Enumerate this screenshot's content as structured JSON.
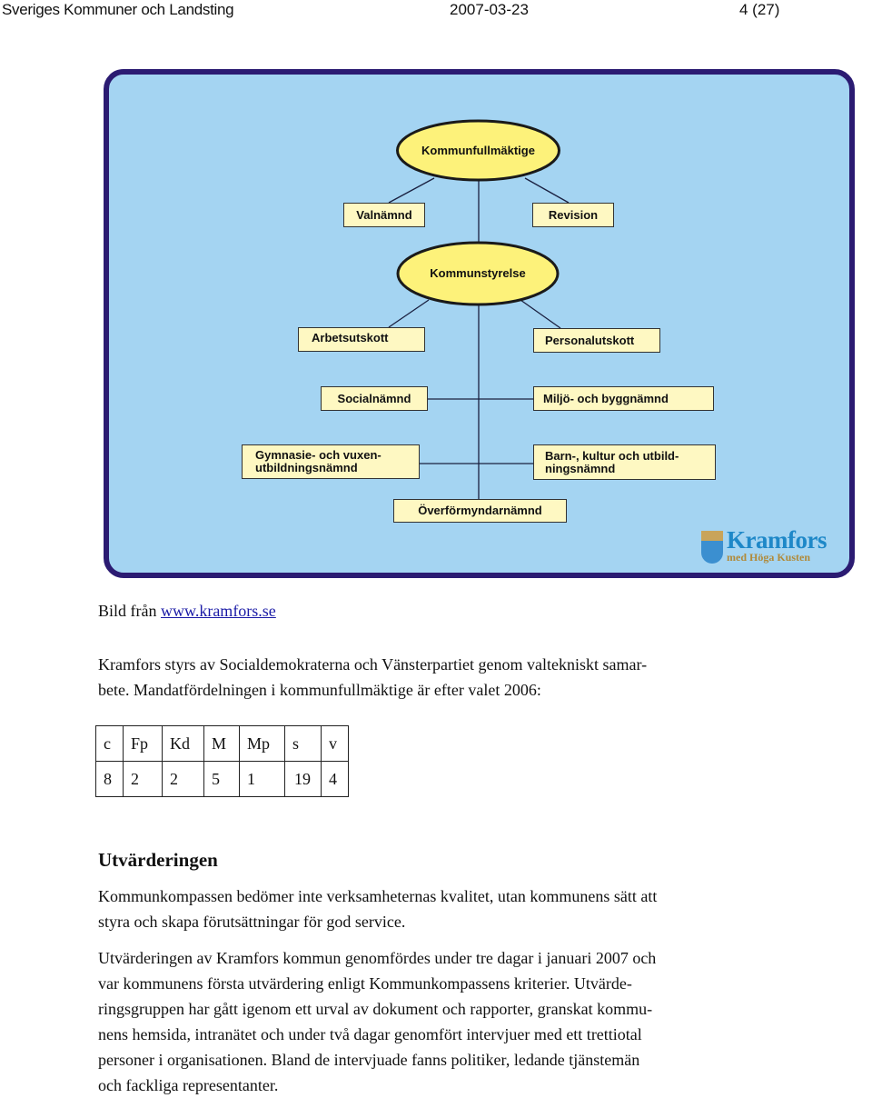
{
  "header": {
    "organization": "Sveriges Kommuner och Landsting",
    "date": "2007-03-23",
    "page": "4 (27)"
  },
  "diagram": {
    "colors": {
      "frame_border": "#2b1b72",
      "background": "#a4d4f2",
      "node_fill": "#fef8c2",
      "ellipse_fill": "#fdf27a"
    },
    "top_ellipse": "Kommunfullmäktige",
    "second_ellipse": "Kommunstyrelse",
    "boxes": {
      "valnamnd": "Valnämnd",
      "revision": "Revision",
      "arbetsutskott": "Arbetsutskott",
      "personalutskott": "Personalutskott",
      "socialnamnd": "Socialnämnd",
      "miljo": "Miljö- och byggnämnd",
      "gymnasie": "Gymnasie- och vuxen-\nutbildningsnämnd",
      "barn": "Barn-, kultur och utbild-\nningsnämnd",
      "overformyndar": "Överförmyndarnämnd"
    },
    "logo": {
      "name": "Kramfors",
      "tagline": "med Höga Kusten"
    }
  },
  "caption": {
    "prefix": "Bild från ",
    "link": "www.kramfors.se"
  },
  "intro": {
    "lines": [
      "Kramfors styrs av Socialdemokraterna och Vänsterpartiet genom valtekniskt samar-",
      "bete. Mandatfördelningen i kommunfullmäktige är efter valet 2006:"
    ]
  },
  "mandate_table": {
    "headers": [
      "c",
      "Fp",
      "Kd",
      "M",
      "Mp",
      "s",
      "v"
    ],
    "values": [
      "8",
      "2",
      "2",
      "5",
      "1",
      "19",
      "4"
    ]
  },
  "section": {
    "heading": "Utvärderingen",
    "para1_lines": [
      "Kommunkompassen bedömer inte verksamheternas kvalitet, utan kommunens sätt att",
      "styra och skapa förutsättningar för god service."
    ],
    "para2_lines": [
      "Utvärderingen av Kramfors kommun genomfördes under tre dagar i januari 2007 och",
      "var kommunens första utvärdering enligt Kommunkompassens kriterier. Utvärde-",
      "ringsgruppen har gått igenom ett urval av dokument och rapporter, granskat kommu-",
      "nens hemsida, intranätet och under två dagar genomfört intervjuer med ett trettiotal",
      "personer i organisationen. Bland de intervjuade fanns politiker, ledande tjänstemän",
      "och fackliga representanter."
    ]
  }
}
